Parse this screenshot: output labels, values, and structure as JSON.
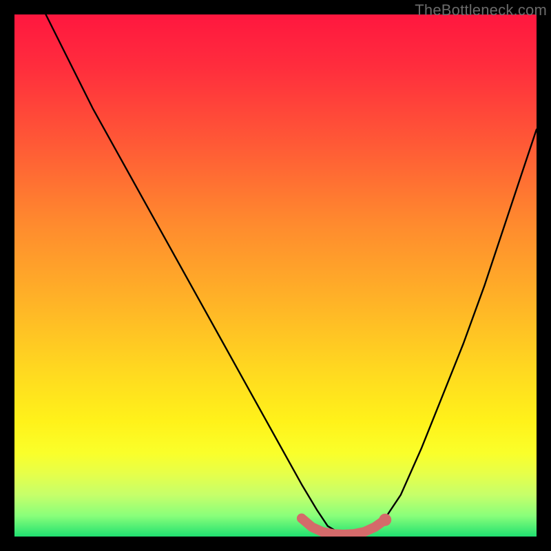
{
  "watermark": "TheBottleneck.com",
  "chart_data": {
    "type": "line",
    "title": "",
    "xlabel": "",
    "ylabel": "",
    "xlim": [
      0,
      100
    ],
    "ylim": [
      0,
      100
    ],
    "series": [
      {
        "name": "bottleneck-curve",
        "color": "#000000",
        "x": [
          6,
          10,
          15,
          20,
          25,
          30,
          35,
          40,
          45,
          50,
          55,
          58,
          60,
          62,
          64,
          66,
          68,
          70,
          74,
          78,
          82,
          86,
          90,
          94,
          98,
          100
        ],
        "values": [
          100,
          92,
          82,
          73,
          64,
          55,
          46,
          37,
          28,
          19,
          10,
          5,
          2,
          0.8,
          0.2,
          0.2,
          0.8,
          2,
          8,
          17,
          27,
          37,
          48,
          60,
          72,
          78
        ]
      },
      {
        "name": "optimal-flat-region",
        "color": "#d46a6a",
        "x": [
          55,
          57,
          59,
          61,
          63,
          65,
          67,
          69,
          71
        ],
        "values": [
          3.5,
          1.8,
          0.9,
          0.5,
          0.4,
          0.5,
          0.9,
          1.8,
          3.2
        ]
      }
    ],
    "markers": [
      {
        "name": "right-dot",
        "x": 71,
        "y": 3.2,
        "color": "#d46a6a"
      }
    ]
  }
}
